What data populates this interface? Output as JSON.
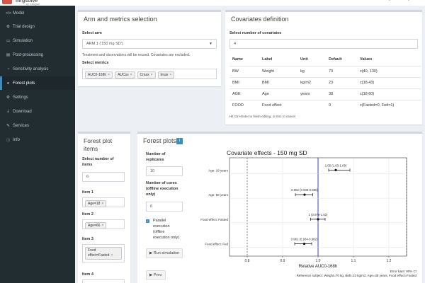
{
  "app": {
    "logo_text": "mrgsolve",
    "logo_sub": "by Calogave"
  },
  "sidebar": {
    "items": [
      {
        "icon": "</>",
        "label": "Model"
      },
      {
        "icon": "⚙",
        "label": "Trial design"
      },
      {
        "icon": "▭",
        "label": "Simulation"
      },
      {
        "icon": "▤",
        "label": "Post-processing"
      },
      {
        "icon": "◔",
        "label": "Sensitivity analysis"
      },
      {
        "icon": "≡",
        "label": "Forest plots"
      },
      {
        "icon": "⚙",
        "label": "Settings"
      },
      {
        "icon": "⤓",
        "label": "Download"
      },
      {
        "icon": "✎",
        "label": "Services"
      },
      {
        "icon": "ⓘ",
        "label": "Info"
      }
    ],
    "active_index": 5
  },
  "arm_panel": {
    "title": "Arm and metrics selection",
    "select_arm_label": "Select arm",
    "arm_value": "ARM 1 ('150 mg SD')",
    "help_text": "Treatment and observations will be reused. Covariates are excluded.",
    "select_metrics_label": "Select metrics",
    "metrics": [
      "AUC0-168h",
      "AUCss",
      "Cmax",
      "tmax"
    ]
  },
  "covariates_panel": {
    "title": "Covariates definition",
    "count_label": "Select number of covariates",
    "count_value": "4",
    "columns": [
      "Name",
      "Label",
      "Unit",
      "Default",
      "Values"
    ],
    "rows": [
      [
        "BW",
        "Weight",
        "kg",
        "70",
        "c(40, 130)"
      ],
      [
        "BMI",
        "BMI",
        "kg/m2",
        "23",
        "c(18,43)"
      ],
      [
        "AGE",
        "Age",
        "years",
        "38",
        "c(18,60)"
      ],
      [
        "FOOD",
        "Food effect",
        "",
        "0",
        "c(Fasted=0, Fed=1)"
      ]
    ],
    "hint": "Hit Ctrl+Enter to finish editing, or Esc to cancel"
  },
  "items_panel": {
    "title_line1": "Forest plot",
    "title_line2": "items",
    "num_items_label_1": "Select number of",
    "num_items_label_2": "items",
    "num_items_value": "6",
    "items": [
      {
        "label": "Item 1",
        "tags": [
          "Age=18"
        ]
      },
      {
        "label": "Item 2",
        "tags": [
          "Age=66"
        ]
      },
      {
        "label": "Item 3",
        "tags": [
          "Food effect=Fasted"
        ]
      },
      {
        "label": "Item 4",
        "tags": []
      }
    ]
  },
  "forest_panel": {
    "title": "Forest plots",
    "info_icon": "i",
    "replicates_label_1": "Number of",
    "replicates_label_2": "replicates",
    "replicates_value": "10",
    "cores_label_1": "Number of cores",
    "cores_label_2": "(offline execution",
    "cores_label_3": "only)",
    "cores_value": "6",
    "parallel_label": [
      "Parallel",
      "execution",
      "(offline",
      "execution only)"
    ],
    "run_label": "Run simulation",
    "prev_label": "Prev."
  },
  "chart_data": {
    "type": "scatter",
    "title": "Covariate effects - 150 mg SD",
    "xlabel": "Relative AUC0-168h",
    "xlim": [
      0.75,
      1.25
    ],
    "xticks": [
      "0.8",
      "0.9",
      "1.0",
      "1.1",
      "1.2"
    ],
    "categories": [
      "Age: 18 years",
      "Age: 66 years",
      "Food effect: Fasted",
      "Food effect: Fed"
    ],
    "points": [
      {
        "label": "Age: 18 years",
        "estimate": 1.05,
        "lower": 1.03,
        "upper": 1.09,
        "annotation": "1.05 (1.03-1.09)"
      },
      {
        "label": "Age: 66 years",
        "estimate": 0.962,
        "lower": 0.936,
        "upper": 0.985,
        "annotation": "0.962 (0.936-0.985)"
      },
      {
        "label": "Food effect: Fasted",
        "estimate": 1.0,
        "lower": 0.979,
        "upper": 1.02,
        "annotation": "1 (0.979-1.02)"
      },
      {
        "label": "Food effect: Fed",
        "estimate": 0.961,
        "lower": 0.934,
        "upper": 0.982,
        "annotation": "0.961 (0.934-0.982)"
      }
    ],
    "reference_lines": [
      0.8,
      1.0,
      1.25
    ],
    "reference_line_color": "#3c3cc8",
    "footnote_1": "Error bars: 90% CI",
    "footnote_2": "Reference subject: Weight=70 kg, BMI=23 kg/m2, Age=38 years, Food effect=Fasted",
    "grid": true
  },
  "colors": {
    "sidebar_bg": "#222d32",
    "sidebar_active": "#1e282c",
    "accent": "#3c8dbc",
    "content_bg": "#ecf0f5"
  }
}
